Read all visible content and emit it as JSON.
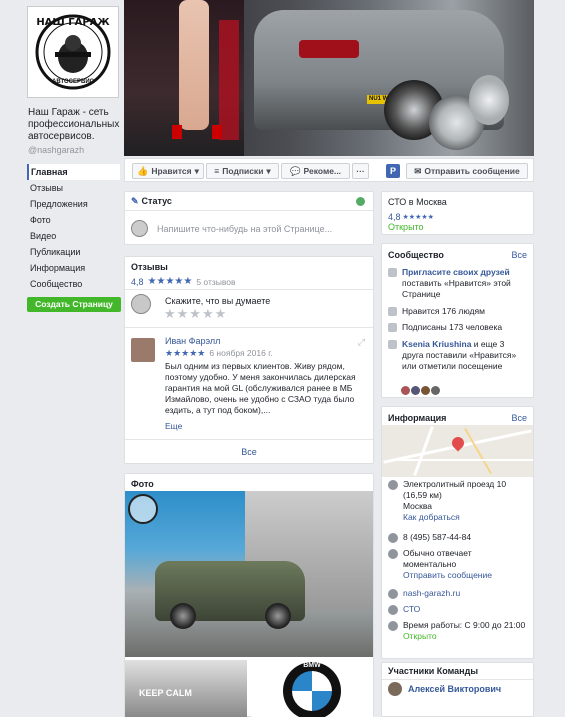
{
  "page": {
    "name": "Наш Гараж - сеть профессиональных автосервисов.",
    "handle": "@nashgarazh",
    "logo_title": "НАШ ГАРАЖ",
    "logo_sub": "АВТОСЕРВИС"
  },
  "nav": {
    "items": [
      "Главная",
      "Отзывы",
      "Предложения",
      "Фото",
      "Видео",
      "Публикации",
      "Информация",
      "Сообщество"
    ],
    "create_page": "Создать Страницу"
  },
  "cover": {
    "plate": "NU1 WCR"
  },
  "actions": {
    "like": "Нравится",
    "subscriptions": "Подписки",
    "recommend": "Рекоме...",
    "more": "···",
    "send_message": "Отправить сообщение"
  },
  "status": {
    "title": "Статус",
    "placeholder": "Напишите что-нибудь на этой Странице..."
  },
  "reviews": {
    "title": "Отзывы",
    "rating": "4,8",
    "stars": "★★★★★",
    "count": "5 отзывов",
    "prompt": "Скажите, что вы думаете",
    "empty_stars": "★★★★★",
    "review": {
      "author": "Иван Фарэлл",
      "stars": "★★★★★",
      "date": "6 ноября 2016 г.",
      "text": "Был одним из первых клиентов. Живу рядом, поэтому удобно. У меня закончилась дилерская гарантия на мой GL (обслуживался ранее в МБ Измайлово, очень не удобно с СЗАО туда было ездить, а тут под боком),...",
      "more": "Еще"
    },
    "all": "Все"
  },
  "photos": {
    "title": "Фото",
    "keep_calm": "KEEP CALM",
    "bmw": "BMW"
  },
  "category": {
    "name": "СТО в Москва",
    "rating": "4,8",
    "stars": "★★★★★",
    "open": "Открыто"
  },
  "community": {
    "title": "Сообщество",
    "all": "Все",
    "invite_link": "Пригласите своих друзей",
    "invite_rest": " поставить «Нравится» этой Странице",
    "likes": "Нравится 176 людям",
    "followers": "Подписаны 173 человека",
    "friend_name": "Ksenia Kriushina",
    "friend_rest": " и еще 3 друга поставили «Нравится» или отметили посещение"
  },
  "info": {
    "title": "Информация",
    "all": "Все",
    "address": "Электролитный проезд 10 (16,59 км)",
    "city": "Москва",
    "directions": "Как добраться",
    "phone": "8 (495) 587-44-84",
    "response": "Обычно отвечает моментально",
    "send_message": "Отправить сообщение",
    "website": "nash-garazh.ru",
    "category": "СТО",
    "hours": "Время работы: С 9:00 до 21:00",
    "open": "Открыто"
  },
  "team": {
    "title": "Участники Команды",
    "member": "Алексей Викторович"
  },
  "colors": {
    "brand_blue": "#4267b2",
    "link": "#365899",
    "green": "#42b72a",
    "bg": "#e9ebee"
  }
}
